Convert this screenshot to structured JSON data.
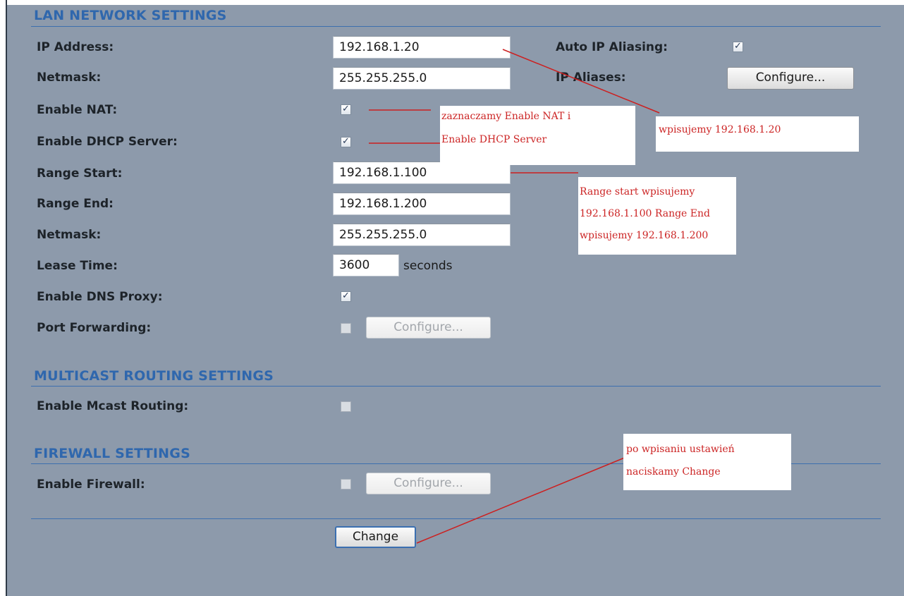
{
  "sections": {
    "lan": "LAN NETWORK SETTINGS",
    "multicast": "MULTICAST ROUTING SETTINGS",
    "firewall": "FIREWALL SETTINGS"
  },
  "lan": {
    "ip_address_label": "IP Address:",
    "ip_address_value": "192.168.1.20",
    "netmask_label": "Netmask:",
    "netmask_value": "255.255.255.0",
    "auto_ip_aliasing_label": "Auto IP Aliasing:",
    "auto_ip_aliasing_checked": true,
    "ip_aliases_label": "IP Aliases:",
    "ip_aliases_button": "Configure...",
    "enable_nat_label": "Enable NAT:",
    "enable_nat_checked": true,
    "enable_dhcp_label": "Enable DHCP Server:",
    "enable_dhcp_checked": true,
    "range_start_label": "Range Start:",
    "range_start_value": "192.168.1.100",
    "range_end_label": "Range End:",
    "range_end_value": "192.168.1.200",
    "dhcp_netmask_label": "Netmask:",
    "dhcp_netmask_value": "255.255.255.0",
    "lease_time_label": "Lease Time:",
    "lease_time_value": "3600",
    "lease_time_unit": "seconds",
    "enable_dns_proxy_label": "Enable DNS Proxy:",
    "enable_dns_proxy_checked": true,
    "port_forwarding_label": "Port Forwarding:",
    "port_forwarding_checked": false,
    "port_forwarding_button": "Configure..."
  },
  "multicast": {
    "enable_mcast_label": "Enable Mcast Routing:",
    "enable_mcast_checked": false
  },
  "firewall": {
    "enable_firewall_label": "Enable Firewall:",
    "enable_firewall_checked": false,
    "firewall_button": "Configure..."
  },
  "change_button": "Change",
  "annotations": {
    "nat_dhcp": [
      "zaznaczamy Enable NAT i",
      "Enable DHCP Server"
    ],
    "ip": [
      "wpisujemy 192.168.1.20"
    ],
    "range": [
      "Range start wpisujemy",
      "192.168.1.100 Range End",
      "wpisujemy 192.168.1.200"
    ],
    "change": [
      "po wpisaniu ustawień",
      "naciskamy Change"
    ]
  },
  "colors": {
    "background": "#8d9aab",
    "section_title": "#2f67ad",
    "annotation_text": "#cc2525"
  }
}
